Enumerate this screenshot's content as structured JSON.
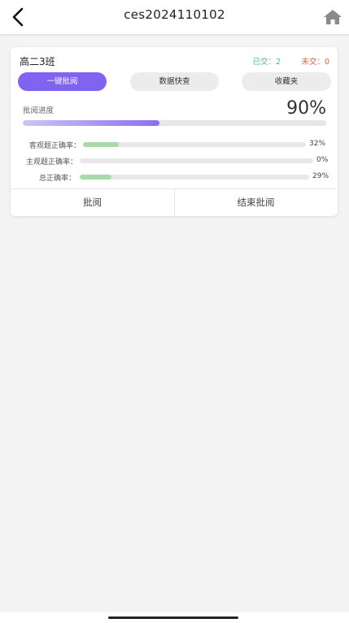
{
  "header": {
    "title": "ces2024110102",
    "back_icon": "chevron-left-icon",
    "home_icon": "home-icon"
  },
  "card": {
    "class_name": "高二3班",
    "submitted_label": "已交：2",
    "unsubmitted_label": "未交：0",
    "tabs": [
      "一键批阅",
      "数据快查",
      "收藏夹"
    ],
    "progress": {
      "label": "批阅进度",
      "percent_text": "90%",
      "fill_fraction": 0.45
    },
    "accuracy": [
      {
        "label": "客观题正确率：",
        "value_text": "32%",
        "fill_fraction": 0.16
      },
      {
        "label": "主观题正确率：",
        "value_text": "0%",
        "fill_fraction": 0
      },
      {
        "label": "总正确率：",
        "value_text": "29%",
        "fill_fraction": 0.14
      }
    ],
    "actions": {
      "review_label": "批阅",
      "end_review_label": "结束批阅"
    }
  },
  "colors": {
    "accent": "#8063f0",
    "submitted": "#4ac080",
    "unsubmitted": "#e0643c",
    "accuracy_fill": "#a6dba8"
  }
}
